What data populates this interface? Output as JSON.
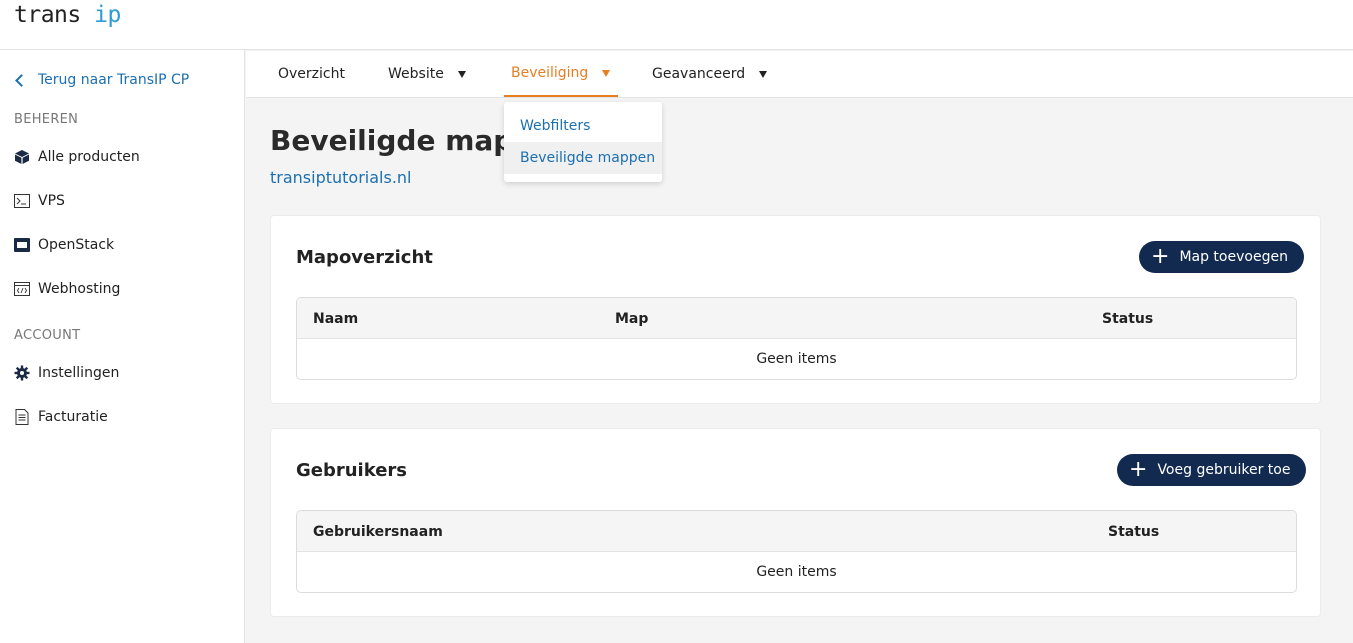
{
  "logo": {
    "part1": "trans",
    "part2": "ip"
  },
  "sidebar": {
    "back_label": "Terug naar TransIP CP",
    "section_beheren": "BEHEREN",
    "section_account": "ACCOUNT",
    "items": [
      {
        "label": "Alle producten",
        "icon": "cube-icon"
      },
      {
        "label": "VPS",
        "icon": "terminal-icon"
      },
      {
        "label": "OpenStack",
        "icon": "server-icon"
      },
      {
        "label": "Webhosting",
        "icon": "code-window-icon"
      },
      {
        "label": "Instellingen",
        "icon": "gear-icon"
      },
      {
        "label": "Facturatie",
        "icon": "document-icon"
      }
    ]
  },
  "nav": {
    "tabs": [
      {
        "label": "Overzicht"
      },
      {
        "label": "Website"
      },
      {
        "label": "Beveiliging"
      },
      {
        "label": "Geavanceerd"
      }
    ],
    "dropdown": [
      "Webfilters",
      "Beveiligde mappen"
    ]
  },
  "page": {
    "title": "Beveiligde mappen",
    "domain": "transiptutorials.nl"
  },
  "folders": {
    "title": "Mapoverzicht",
    "add_button": "Map toevoegen",
    "columns": [
      "Naam",
      "Map",
      "Status"
    ],
    "empty": "Geen items"
  },
  "users": {
    "title": "Gebruikers",
    "add_button": "Voeg gebruiker toe",
    "columns": [
      "Gebruikersnaam",
      "Status"
    ],
    "empty": "Geen items"
  },
  "colors": {
    "accent": "#e67e22",
    "link": "#1c6fb0",
    "button": "#132a50"
  }
}
